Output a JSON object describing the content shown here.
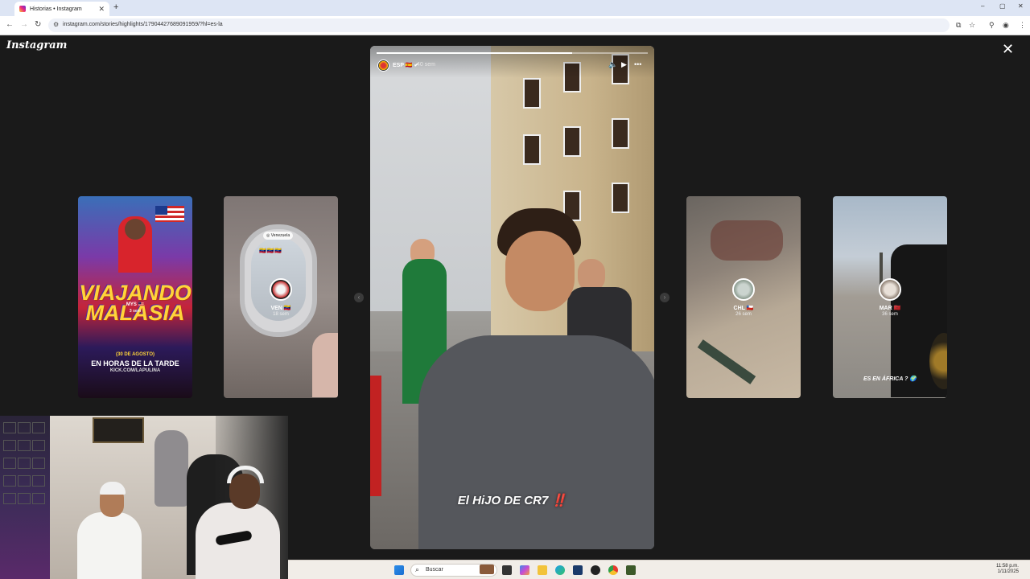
{
  "browser": {
    "tab_title": "Historias • Instagram",
    "tab_close": "✕",
    "new_tab": "+",
    "url": "instagram.com/stories/highlights/17904427689091959/?hl=es-la",
    "window_controls": [
      "–",
      "▢",
      "✕"
    ]
  },
  "instagram": {
    "logo": "Instagram",
    "close": "✕"
  },
  "main_story": {
    "username": "ESP",
    "flag": "🇪🇸",
    "verified": "✔",
    "time": "40 sem",
    "caption": "El HiJO DE CR7",
    "caption_mark": "‼️",
    "progress": 0.72,
    "controls": {
      "mute": "🔈",
      "play": "▶",
      "more": "•••"
    }
  },
  "side_stories": [
    {
      "name": "MYS",
      "flag": "🇲🇾",
      "time": "3 sem",
      "title_line1": "VIAJANDO",
      "title_line2": "MALASIA",
      "date_line": "(30 DE AGOSTO)",
      "subtitle": "EN HORAS DE LA TARDE",
      "link": "KICK.COM/LAPULINA"
    },
    {
      "name": "VEN",
      "flag": "🇻🇪",
      "time": "18 sem",
      "tag": "◎ Venezuela",
      "flags": "🇻🇪🇻🇪🇻🇪"
    },
    {
      "name": "CHL",
      "flag": "🇨🇱",
      "time": "26 sem"
    },
    {
      "name": "MAR",
      "flag": "🇲🇦",
      "time": "36 sem",
      "caption": "ES EN ÁFRICA ? 🌍"
    }
  ],
  "taskbar": {
    "search_placeholder": "Buscar",
    "time": "11:58 p.m.",
    "date": "1/11/2025"
  }
}
